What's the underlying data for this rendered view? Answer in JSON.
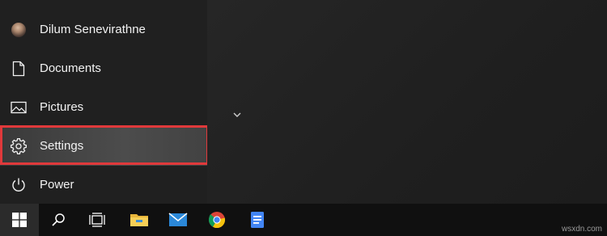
{
  "start_menu": {
    "items": [
      {
        "label": "Dilum Senevirathne",
        "icon": "user-avatar"
      },
      {
        "label": "Documents",
        "icon": "document-icon"
      },
      {
        "label": "Pictures",
        "icon": "pictures-icon"
      },
      {
        "label": "Settings",
        "icon": "gear-icon"
      },
      {
        "label": "Power",
        "icon": "power-icon"
      }
    ],
    "highlighted_item": "Settings",
    "highlight_color": "#e0393b"
  },
  "taskbar": {
    "buttons": [
      {
        "icon": "windows-logo-icon"
      },
      {
        "icon": "search-icon"
      },
      {
        "icon": "task-view-icon"
      },
      {
        "icon": "file-explorer-icon"
      },
      {
        "icon": "mail-icon"
      },
      {
        "icon": "chrome-icon"
      },
      {
        "icon": "google-docs-icon"
      }
    ]
  },
  "watermark": "wsxdn.com"
}
